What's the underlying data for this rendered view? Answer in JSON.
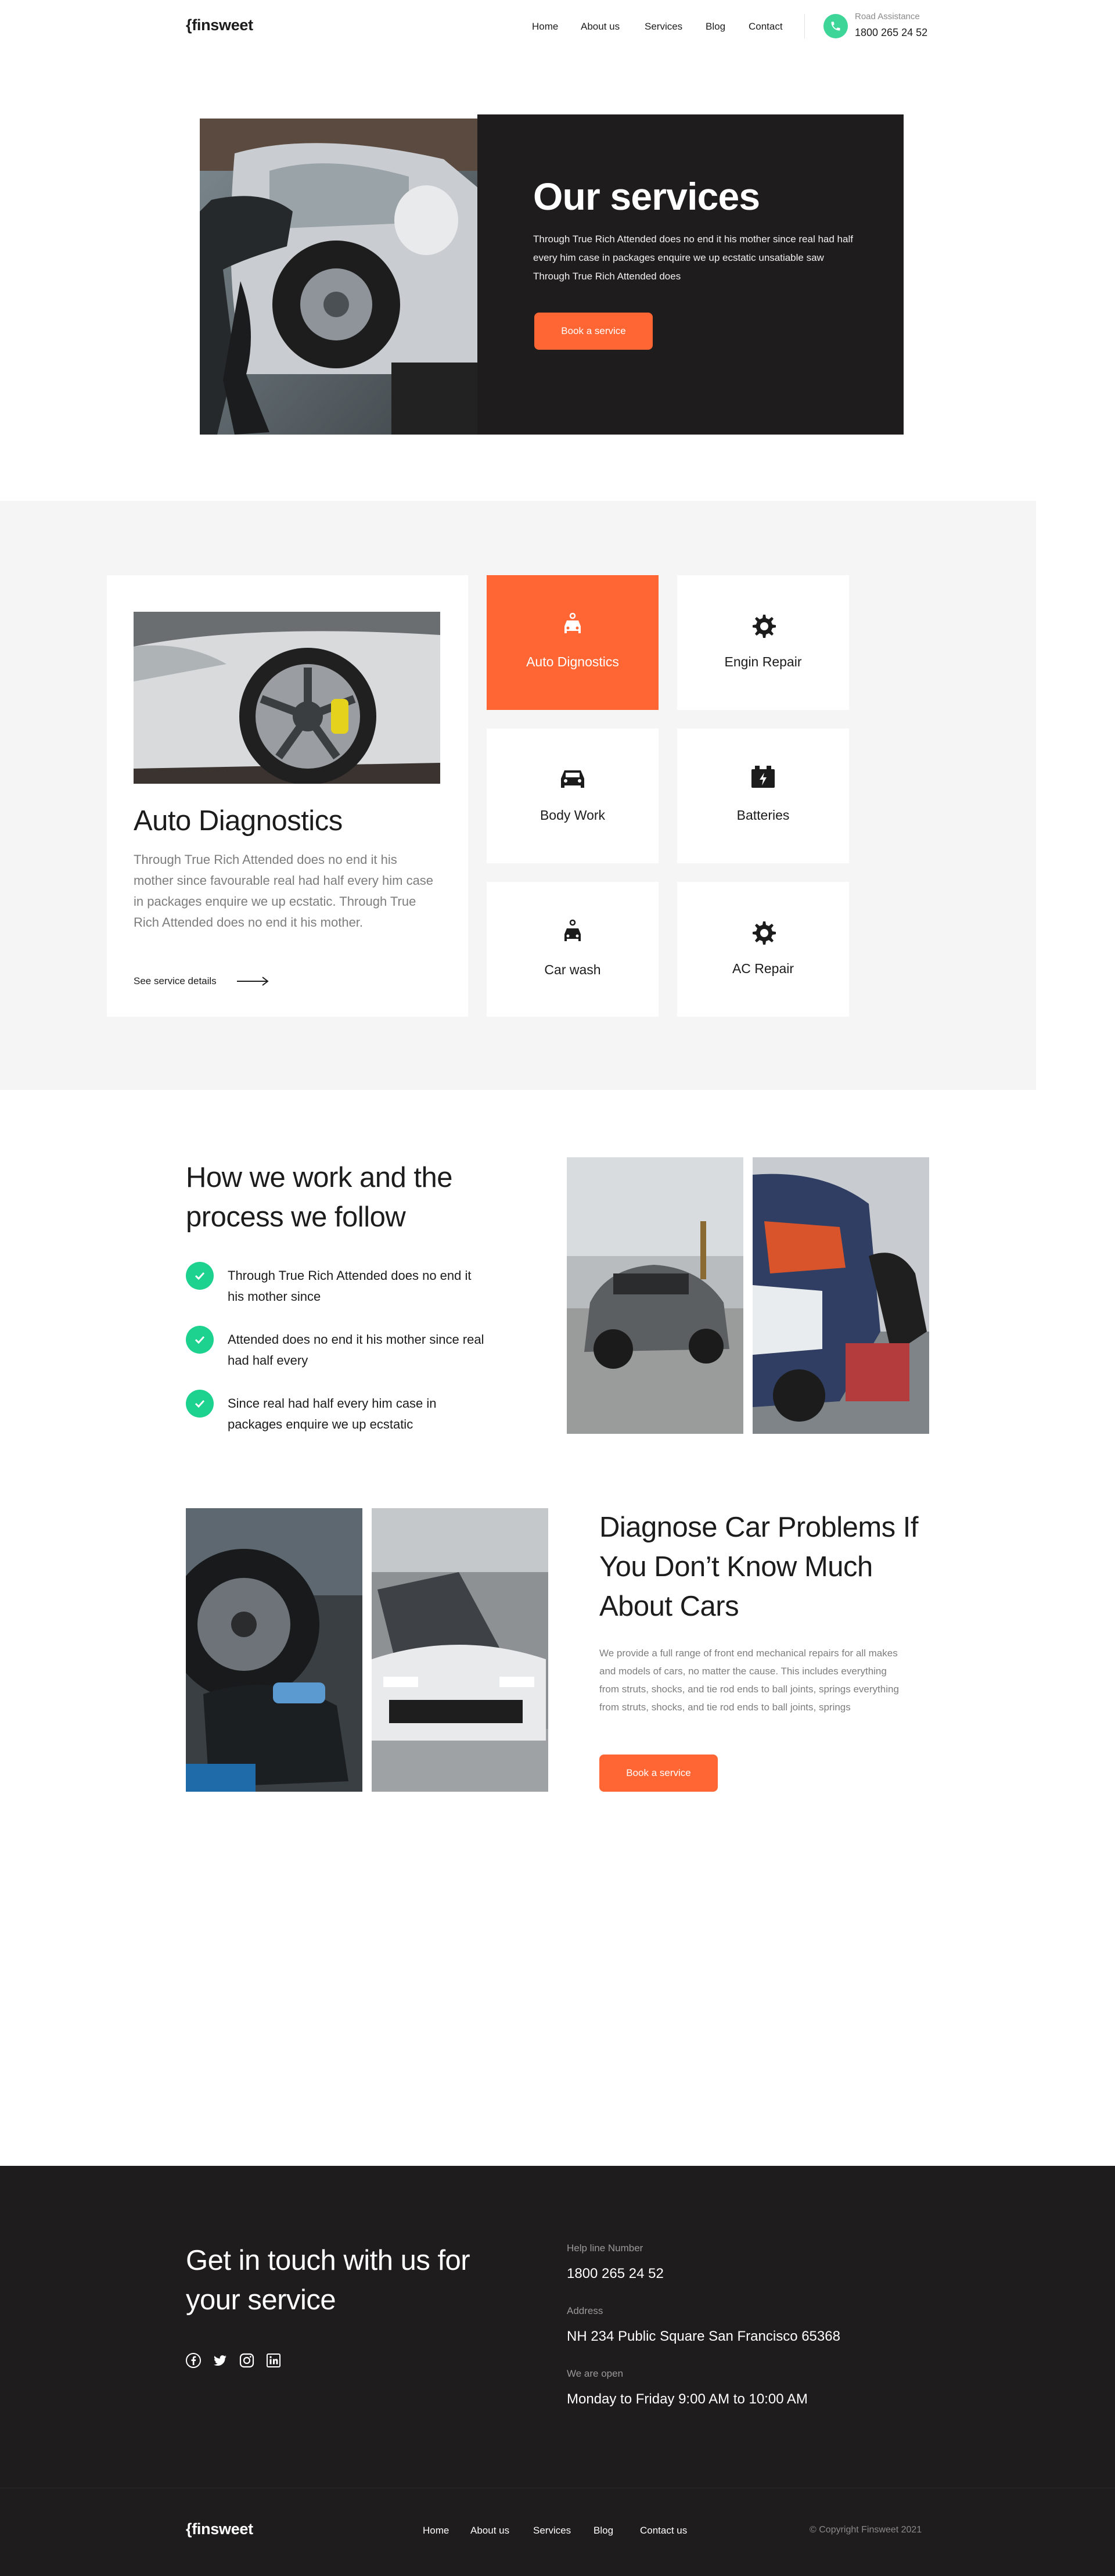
{
  "brand": {
    "logo": "{finsweet",
    "accent": "#ff6633",
    "dark": "#1e1c1c",
    "green": "#1dd18e"
  },
  "nav": {
    "links": [
      "Home",
      "About us",
      "Services",
      "Blog",
      "Contact"
    ],
    "assist_label": "Road Assistance",
    "assist_number": "1800 265 24 52"
  },
  "hero": {
    "title": "Our services",
    "text": "Through True Rich Attended does no end it his mother since real had half every him case in packages enquire we up ecstatic unsatiable saw Through True Rich Attended does",
    "button": "Book a service"
  },
  "services": {
    "detail": {
      "title": "Auto Diagnostics",
      "text": "Through True Rich Attended does no end it his mother since favourable real had half every him case in packages enquire we up ecstatic. Through True Rich Attended does no end it his mother.",
      "link": "See service details"
    },
    "tiles": [
      {
        "label": "Auto Dignostics",
        "icon": "car-wash-icon"
      },
      {
        "label": "Engin Repair",
        "icon": "engine-gear-icon"
      },
      {
        "label": "Body Work",
        "icon": "car-icon"
      },
      {
        "label": "Batteries",
        "icon": "battery-icon"
      },
      {
        "label": "Car wash",
        "icon": "car-wash-icon"
      },
      {
        "label": "AC Repair",
        "icon": "engine-gear-icon"
      }
    ]
  },
  "process": {
    "title": "How we work and the process we follow",
    "steps": [
      "Through True Rich Attended does no end it his mother since",
      "Attended does no end it his mother since real had half every",
      "Since real had half every him case in packages enquire we up ecstatic"
    ]
  },
  "diagnose": {
    "title": "Diagnose Car Problems If You Don’t Know Much About Cars",
    "text": "We provide a full range of front end mechanical repairs for all makes and models of cars, no matter the cause. This includes everything from struts, shocks, and tie rod ends to ball joints, springs everything from struts, shocks, and tie rod ends to ball joints, springs",
    "button": "Book a service"
  },
  "footer": {
    "title": "Get in touch with us for your  service",
    "help_label": "Help line Number",
    "help_value": "1800 265 24 52",
    "address_label": "Address",
    "address_value": "NH 234  Public Square San Francisco  65368",
    "open_label": "We are open",
    "open_value": "Monday to Friday 9:00 AM to  10:00  AM",
    "social": [
      "facebook-icon",
      "twitter-icon",
      "instagram-icon",
      "linkedin-icon"
    ],
    "logo": "{finsweet",
    "links": [
      "Home",
      "About us",
      "Services",
      "Blog",
      "Contact us"
    ],
    "copyright": "© Copyright Finsweet 2021"
  }
}
